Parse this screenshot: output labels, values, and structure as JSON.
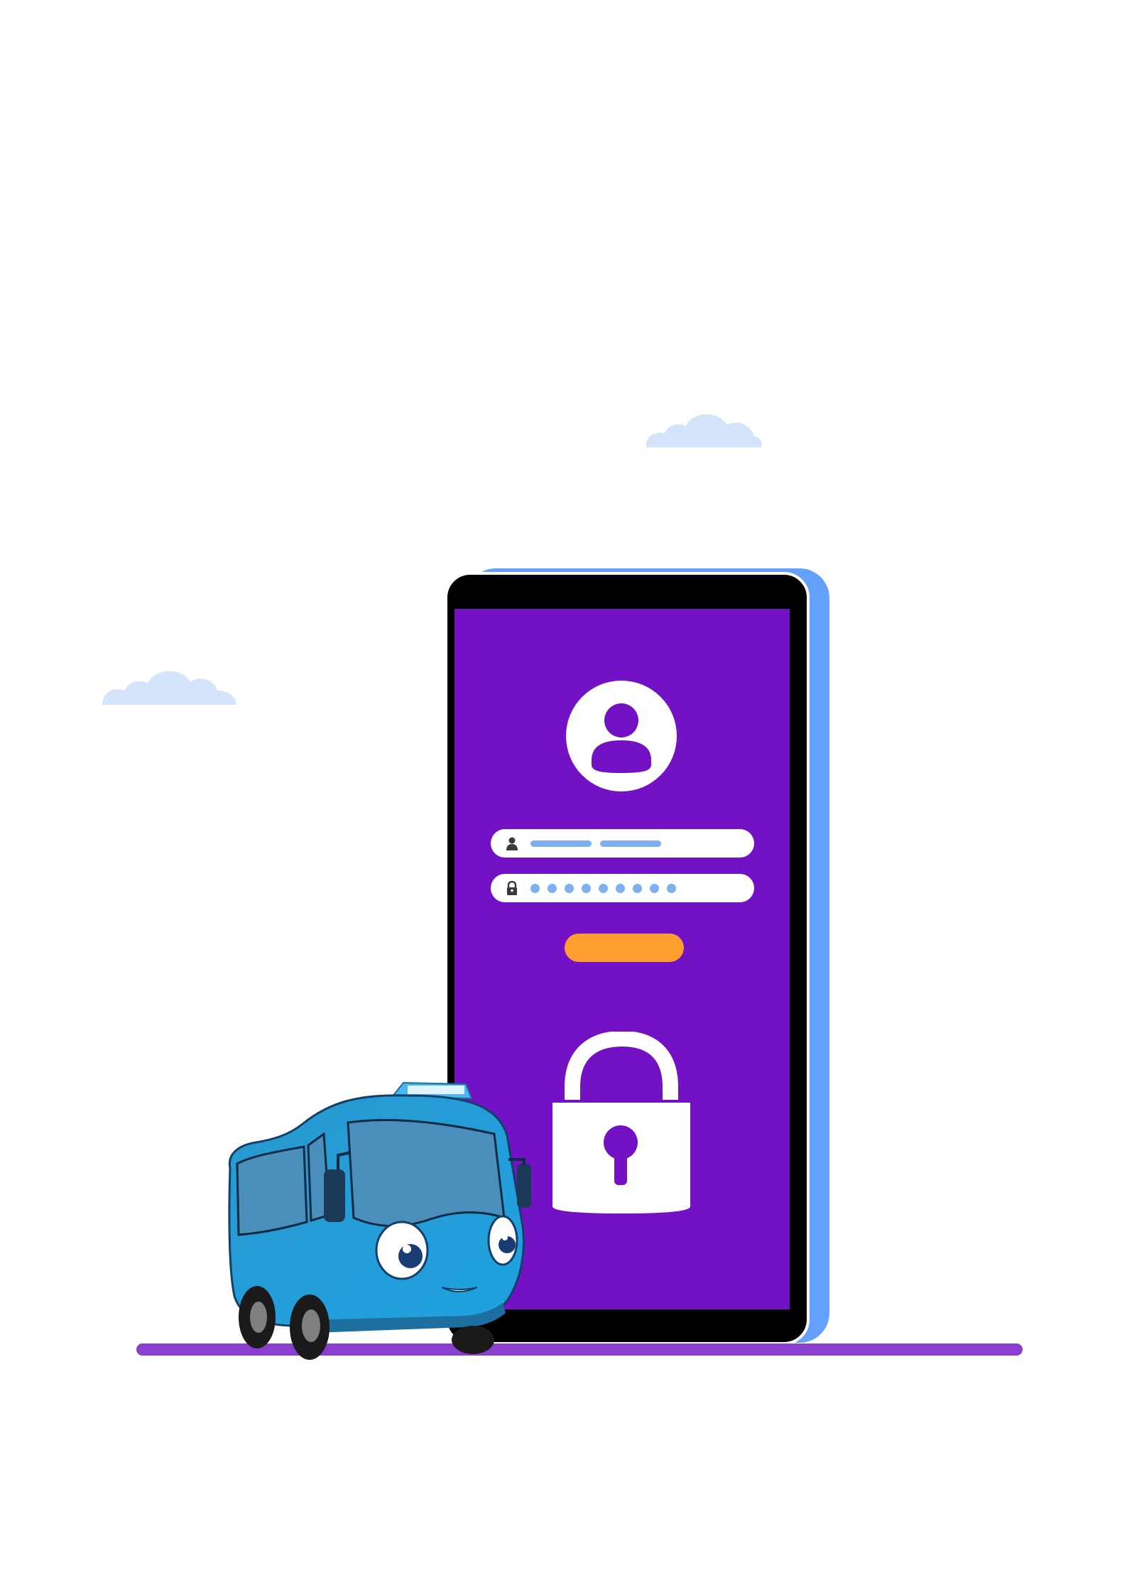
{
  "scene": {
    "colors": {
      "background": "#ffffff",
      "cloud": "#d4e4fa",
      "phone_shadow": "#64a0ff",
      "phone_frame": "#000000",
      "screen": "#7212c4",
      "field": "#ffffff",
      "field_placeholder": "#7cb0f0",
      "button": "#ff9e30",
      "ground": "#8a3fd0",
      "bus": "#2aa4dc"
    },
    "login": {
      "avatar_icon": "user-avatar-icon",
      "username_icon": "user-icon",
      "password_icon": "lock-icon",
      "username_placeholder_dashes": 2,
      "password_placeholder_dots": 9,
      "padlock_icon": "padlock-icon"
    },
    "illustrations": [
      "cloud-icon",
      "bus-character",
      "smartphone"
    ]
  }
}
